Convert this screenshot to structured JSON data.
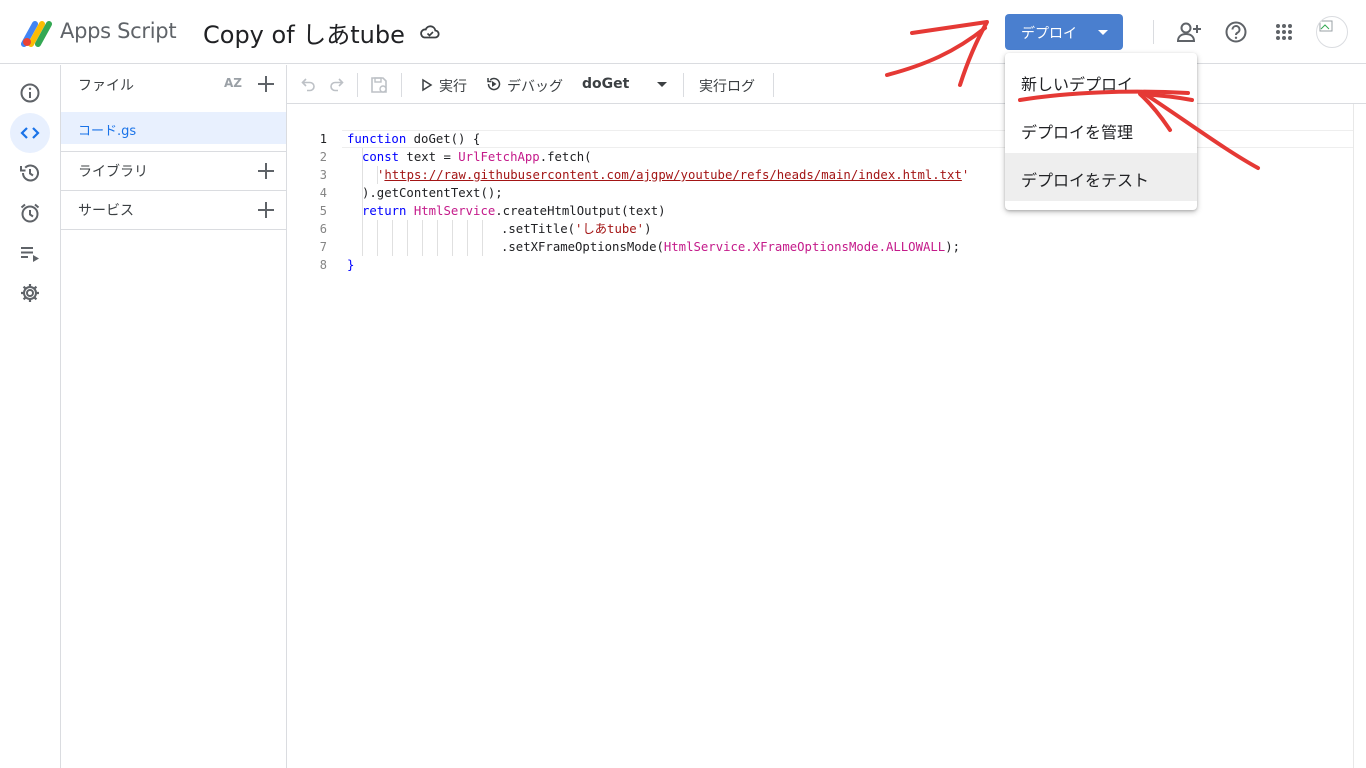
{
  "header": {
    "app_name": "Apps Script",
    "project_title": "Copy of しあtube",
    "deploy_label": "デプロイ"
  },
  "deploy_menu": {
    "items": [
      {
        "label": "新しいデプロイ"
      },
      {
        "label": "デプロイを管理"
      },
      {
        "label": "デプロイをテスト"
      }
    ]
  },
  "files_panel": {
    "files_title": "ファイル",
    "sort_icon_text": "AZ",
    "active_file": "コード.gs",
    "libraries_title": "ライブラリ",
    "services_title": "サービス"
  },
  "toolbar": {
    "run_label": "実行",
    "debug_label": "デバッグ",
    "function_select": "doGet",
    "log_label": "実行ログ"
  },
  "editor": {
    "line_numbers": [
      "1",
      "2",
      "3",
      "4",
      "5",
      "6",
      "7",
      "8"
    ],
    "code": {
      "l1_kw": "function",
      "l1_rest": " doGet() {",
      "l2_kw": "const",
      "l2_mid": " text = ",
      "l2_cls": "UrlFetchApp",
      "l2_rest": ".fetch(",
      "l3_q1": "'",
      "l3_url": "https://raw.githubusercontent.com/ajgpw/youtube/refs/heads/main/index.html.txt",
      "l3_q2": "'",
      "l4_rest": ").getContentText();",
      "l5_kw": "return",
      "l5_cls": "HtmlService",
      "l5_rest": ".createHtmlOutput(text)",
      "l6_pre": ".setTitle(",
      "l6_str": "'しあtube'",
      "l6_post": ")",
      "l7_pre": ".setXFrameOptionsMode(",
      "l7_cls": "HtmlService.XFrameOptionsMode.ALLOWALL",
      "l7_post": ");",
      "l8": "}"
    }
  },
  "colors": {
    "accent": "#4a7fcf",
    "annotation": "#e53935",
    "active_file_bg": "#e8f0fe"
  }
}
